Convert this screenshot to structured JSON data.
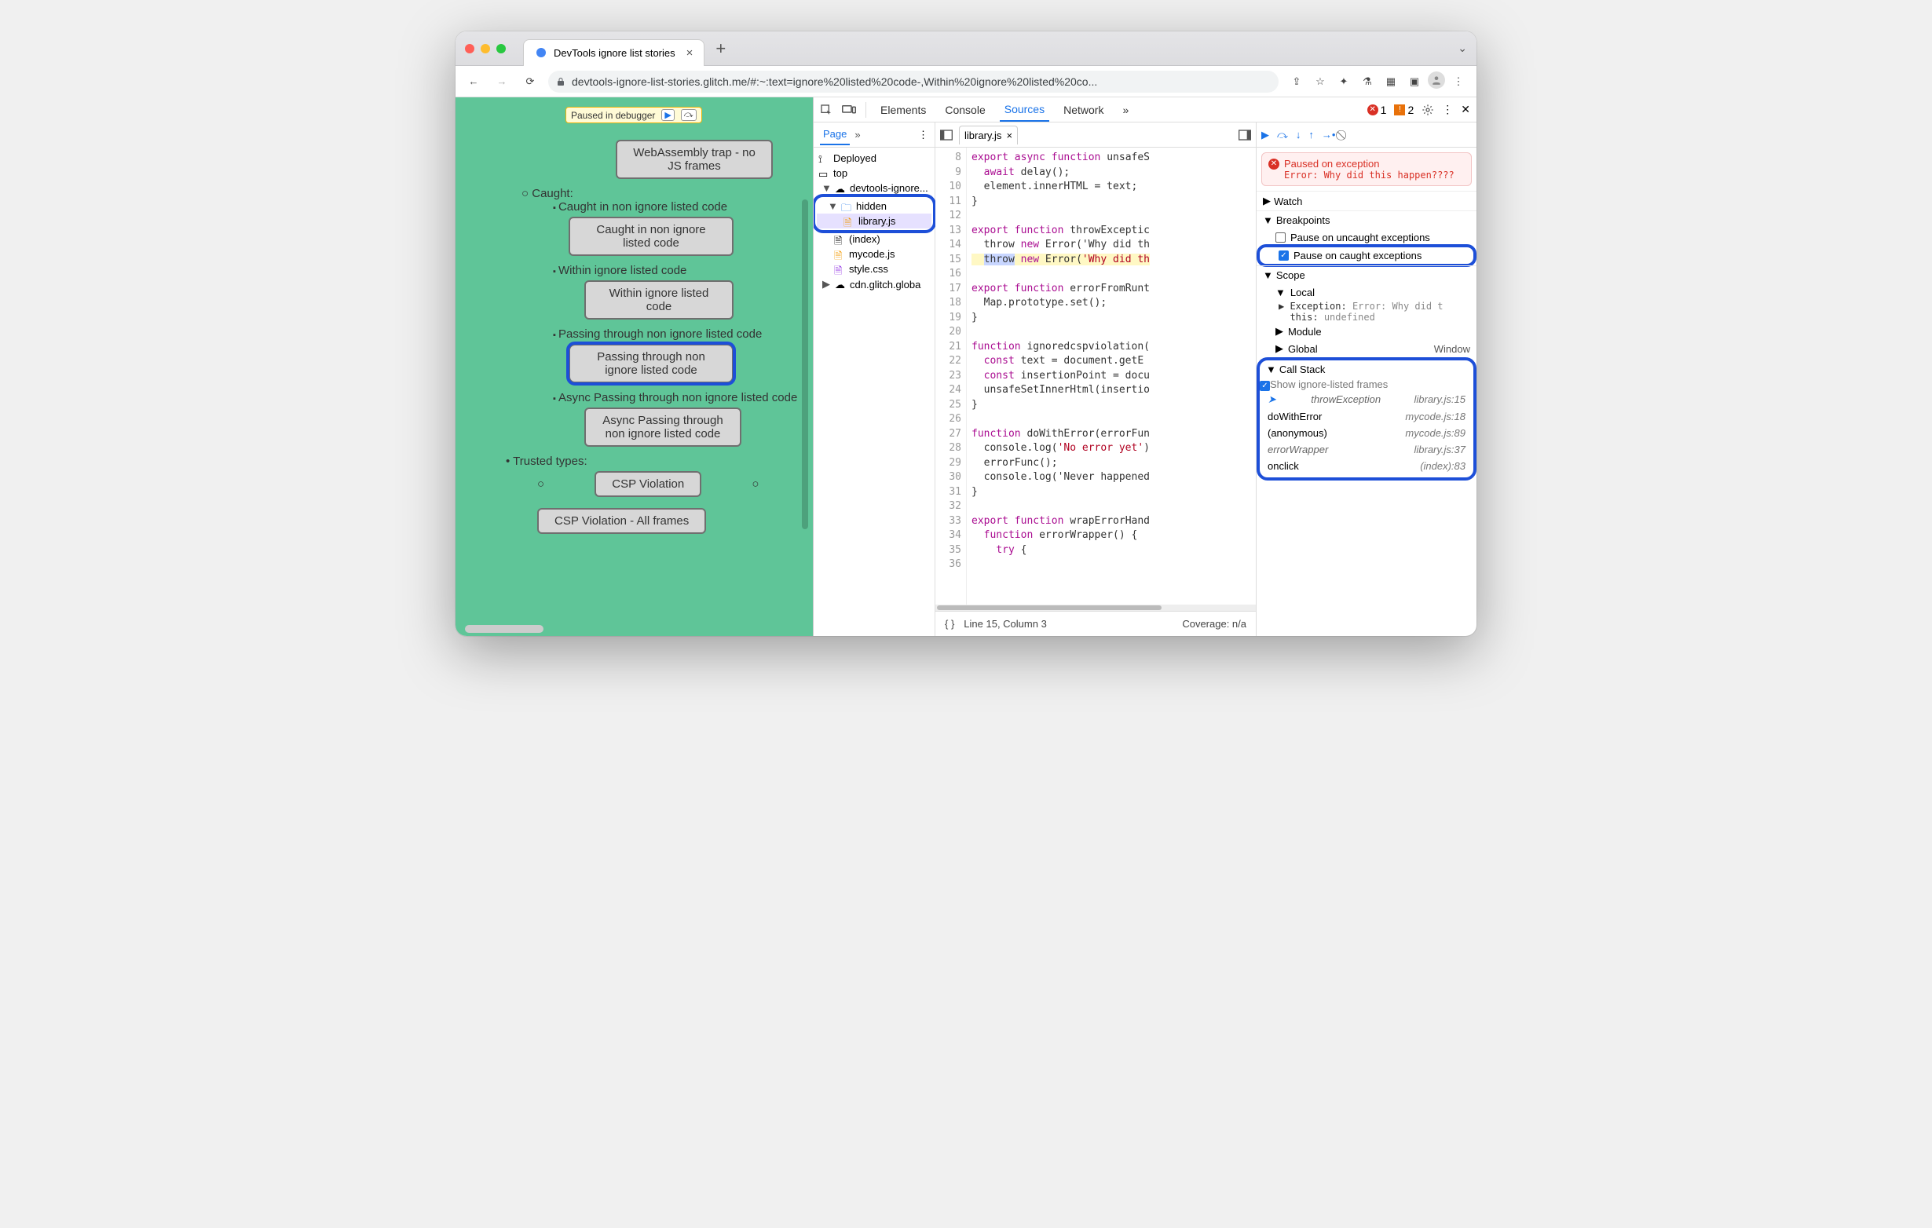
{
  "tab": {
    "title": "DevTools ignore list stories",
    "close": "×",
    "new": "+",
    "overflow": "⌄"
  },
  "toolbar": {
    "url": "devtools-ignore-list-stories.glitch.me/#:~:text=ignore%20listed%20code-,Within%20ignore%20listed%20co..."
  },
  "page": {
    "paused": "Paused in debugger",
    "first_btn": "WebAssembly trap - no JS frames",
    "caught": "Caught:",
    "i1": "Caught in non ignore listed code",
    "b1": "Caught in non ignore listed code",
    "i2": "Within ignore listed code",
    "b2": "Within ignore listed code",
    "i3": "Passing through non ignore listed code",
    "b3": "Passing through non ignore listed code",
    "i4": "Async Passing through non ignore listed code",
    "b4": "Async Passing through non ignore listed code",
    "tt": "Trusted types:",
    "tb1": "CSP Violation",
    "tb2": "CSP Violation - All frames"
  },
  "dt": {
    "tabs": {
      "elements": "Elements",
      "console": "Console",
      "sources": "Sources",
      "network": "Network",
      "more": "»"
    },
    "errcount": "1",
    "warncount": "2"
  },
  "nav": {
    "page": "Page",
    "more": "»",
    "deployed": "Deployed",
    "top": "top",
    "site": "devtools-ignore...",
    "hidden": "hidden",
    "library": "library.js",
    "index": "(index)",
    "mycode": "mycode.js",
    "style": "style.css",
    "cdn": "cdn.glitch.globa"
  },
  "editor": {
    "file": "library.js",
    "lines_start": 8,
    "lines": [
      "export async function unsafeS",
      "  await delay();",
      "  element.innerHTML = text;",
      "}",
      "",
      "export function throwExceptic",
      "  throw new Error('Why did th",
      "}",
      "",
      "export function errorFromRunt",
      "  Map.prototype.set();",
      "}",
      "",
      "function ignoredcspviolation(",
      "  const text = document.getE",
      "  const insertionPoint = docu",
      "  unsafeSetInnerHtml(insertio",
      "}",
      "",
      "function doWithError(errorFun",
      "  console.log('No error yet')",
      "  errorFunc();",
      "  console.log('Never happened",
      "}",
      "",
      "export function wrapErrorHand",
      "  function errorWrapper() {",
      "    try {",
      ""
    ],
    "status_left": "Line 15, Column 3",
    "status_right": "Coverage: n/a"
  },
  "dbg": {
    "pause_title": "Paused on exception",
    "pause_msg": "Error: Why did this happen????",
    "watch": "Watch",
    "breakpoints": "Breakpoints",
    "bp1": "Pause on uncaught exceptions",
    "bp2": "Pause on caught exceptions",
    "scope": "Scope",
    "local": "Local",
    "exc": "Exception",
    "exc_v": "Error: Why did t",
    "thisk": "this",
    "thisv": "undefined",
    "module": "Module",
    "global": "Global",
    "global_v": "Window",
    "callstack": "Call Stack",
    "show_ignored": "Show ignore-listed frames",
    "frames": [
      {
        "name": "throwException",
        "loc": "library.js:15",
        "it": true,
        "curr": true
      },
      {
        "name": "doWithError",
        "loc": "mycode.js:18"
      },
      {
        "name": "(anonymous)",
        "loc": "mycode.js:89"
      },
      {
        "name": "errorWrapper",
        "loc": "library.js:37",
        "it": true
      },
      {
        "name": "onclick",
        "loc": "(index):83"
      }
    ]
  }
}
